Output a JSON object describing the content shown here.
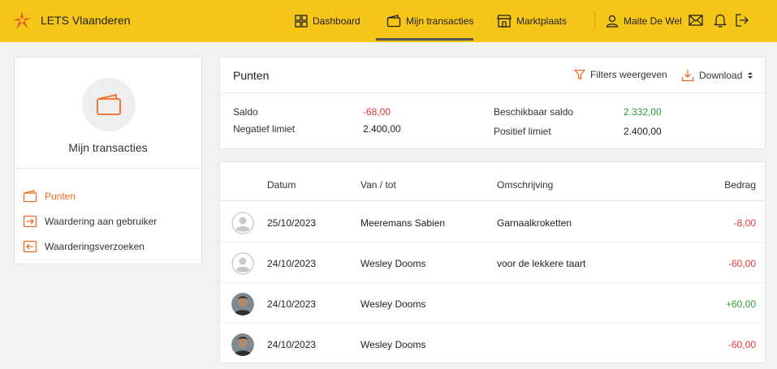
{
  "brand": {
    "name": "LETS Vlaanderen"
  },
  "nav": {
    "dashboard": "Dashboard",
    "transactions": "Mijn transacties",
    "market": "Marktplaats",
    "user": "Maite De Wel"
  },
  "sidebar": {
    "title": "Mijn transacties",
    "items": [
      {
        "label": "Punten",
        "active": true
      },
      {
        "label": "Waardering aan gebruiker"
      },
      {
        "label": "Waarderingsverzoeken"
      }
    ]
  },
  "points": {
    "title": "Punten",
    "filters": "Filters weergeven",
    "download": "Download",
    "saldo_label": "Saldo",
    "saldo_value": "-68,00",
    "neg_limit_label": "Negatief limiet",
    "neg_limit_value": "2.400,00",
    "available_label": "Beschikbaar saldo",
    "available_value": "2.332,00",
    "pos_limit_label": "Positief limiet",
    "pos_limit_value": "2.400,00"
  },
  "table": {
    "headers": {
      "date": "Datum",
      "fromto": "Van / tot",
      "desc": "Omschrijving",
      "amount": "Bedrag"
    },
    "rows": [
      {
        "date": "25/10/2023",
        "fromto": "Meeremans Sabien",
        "desc": "Garnaalkroketten",
        "amount": "-8,00",
        "sign": "neg",
        "avatar": "default"
      },
      {
        "date": "24/10/2023",
        "fromto": "Wesley Dooms",
        "desc": "voor de lekkere taart",
        "amount": "-60,00",
        "sign": "neg",
        "avatar": "default"
      },
      {
        "date": "24/10/2023",
        "fromto": "Wesley Dooms",
        "desc": "",
        "amount": "+60,00",
        "sign": "pos",
        "avatar": "photo"
      },
      {
        "date": "24/10/2023",
        "fromto": "Wesley Dooms",
        "desc": "",
        "amount": "-60,00",
        "sign": "neg",
        "avatar": "photo"
      }
    ]
  },
  "colors": {
    "topbar": "#f5c518",
    "accent": "#f06b22",
    "negative": "#e53935",
    "positive": "#2e9b3a"
  }
}
